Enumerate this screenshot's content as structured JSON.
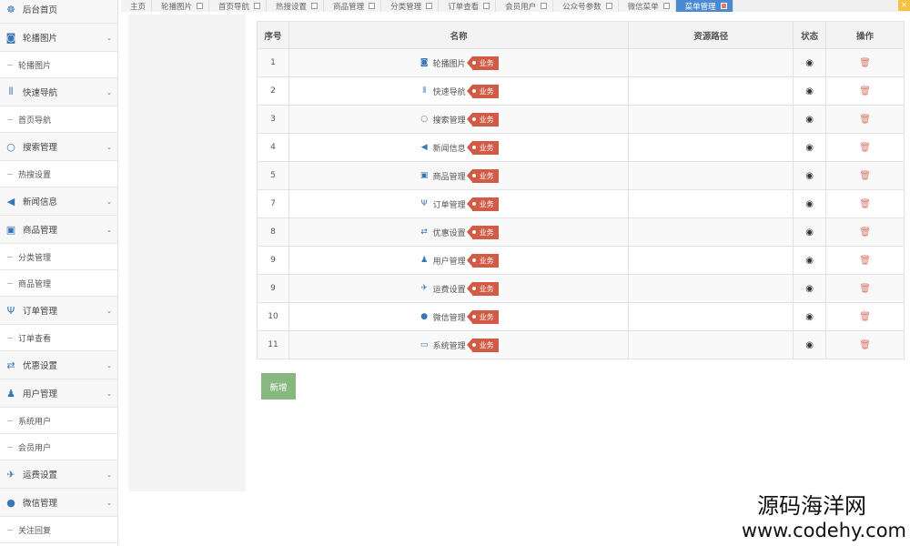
{
  "sidebar": {
    "items": [
      {
        "kind": "menu",
        "icon": "dashboard-icon",
        "label": "后台首页",
        "chevron": false
      },
      {
        "kind": "menu",
        "icon": "camera-icon",
        "label": "轮播图片",
        "chevron": true
      },
      {
        "kind": "sub",
        "label": "轮播图片"
      },
      {
        "kind": "menu",
        "icon": "barcode-icon",
        "label": "快速导航",
        "chevron": true
      },
      {
        "kind": "sub",
        "label": "首页导航"
      },
      {
        "kind": "menu",
        "icon": "circle-icon",
        "label": "搜索管理",
        "chevron": true
      },
      {
        "kind": "sub",
        "label": "热搜设置"
      },
      {
        "kind": "menu",
        "icon": "bullhorn-icon",
        "label": "新闻信息",
        "chevron": true
      },
      {
        "kind": "menu",
        "icon": "gift-icon",
        "label": "商品管理",
        "chevron": true
      },
      {
        "kind": "sub",
        "label": "分类管理"
      },
      {
        "kind": "sub",
        "label": "商品管理"
      },
      {
        "kind": "menu",
        "icon": "cutlery-icon",
        "label": "订单管理",
        "chevron": true
      },
      {
        "kind": "sub",
        "label": "订单查看"
      },
      {
        "kind": "menu",
        "icon": "exchange-icon",
        "label": "优惠设置",
        "chevron": true
      },
      {
        "kind": "menu",
        "icon": "users-icon",
        "label": "用户管理",
        "chevron": true
      },
      {
        "kind": "sub",
        "label": "系统用户"
      },
      {
        "kind": "sub",
        "label": "会员用户"
      },
      {
        "kind": "menu",
        "icon": "plane-icon",
        "label": "运费设置",
        "chevron": true
      },
      {
        "kind": "menu",
        "icon": "comments-icon",
        "label": "微信管理",
        "chevron": true
      },
      {
        "kind": "sub",
        "label": "关注回复"
      }
    ]
  },
  "tabs": [
    {
      "label": "主页",
      "closable": false,
      "active": false
    },
    {
      "label": "轮播图片",
      "closable": true,
      "active": false
    },
    {
      "label": "首页导航",
      "closable": true,
      "active": false
    },
    {
      "label": "热搜设置",
      "closable": true,
      "active": false
    },
    {
      "label": "商品管理",
      "closable": true,
      "active": false
    },
    {
      "label": "分类管理",
      "closable": true,
      "active": false
    },
    {
      "label": "订单查看",
      "closable": true,
      "active": false
    },
    {
      "label": "会员用户",
      "closable": true,
      "active": false
    },
    {
      "label": "公众号参数",
      "closable": true,
      "active": false
    },
    {
      "label": "微信菜单",
      "closable": true,
      "active": false
    },
    {
      "label": "菜单管理",
      "closable": true,
      "active": true
    }
  ],
  "table": {
    "headers": [
      "序号",
      "名称",
      "资源路径",
      "状态",
      "操作"
    ],
    "tag_label": "业务",
    "rows": [
      {
        "idx": "1",
        "icon": "camera-icon",
        "name": "轮播图片",
        "path": ""
      },
      {
        "idx": "2",
        "icon": "barcode-icon",
        "name": "快速导航",
        "path": ""
      },
      {
        "idx": "3",
        "icon": "circle-icon",
        "name": "搜索管理",
        "path": ""
      },
      {
        "idx": "4",
        "icon": "bullhorn-icon",
        "name": "新闻信息",
        "path": ""
      },
      {
        "idx": "5",
        "icon": "gift-icon",
        "name": "商品管理",
        "path": ""
      },
      {
        "idx": "7",
        "icon": "cutlery-icon",
        "name": "订单管理",
        "path": ""
      },
      {
        "idx": "8",
        "icon": "exchange-icon",
        "name": "优惠设置",
        "path": ""
      },
      {
        "idx": "9",
        "icon": "users-icon",
        "name": "用户管理",
        "path": ""
      },
      {
        "idx": "9",
        "icon": "plane-icon",
        "name": "运费设置",
        "path": ""
      },
      {
        "idx": "10",
        "icon": "comments-icon",
        "name": "微信管理",
        "path": ""
      },
      {
        "idx": "11",
        "icon": "desktop-icon",
        "name": "系统管理",
        "path": ""
      }
    ]
  },
  "add_button": {
    "label": "新增"
  },
  "watermark": {
    "title": "源码海洋网",
    "url": "www.codehy.com"
  },
  "colors": {
    "accent": "#3a77b5",
    "tag": "#d15b47",
    "add_button": "#87b87f",
    "active_tab": "#4a8ad1"
  }
}
